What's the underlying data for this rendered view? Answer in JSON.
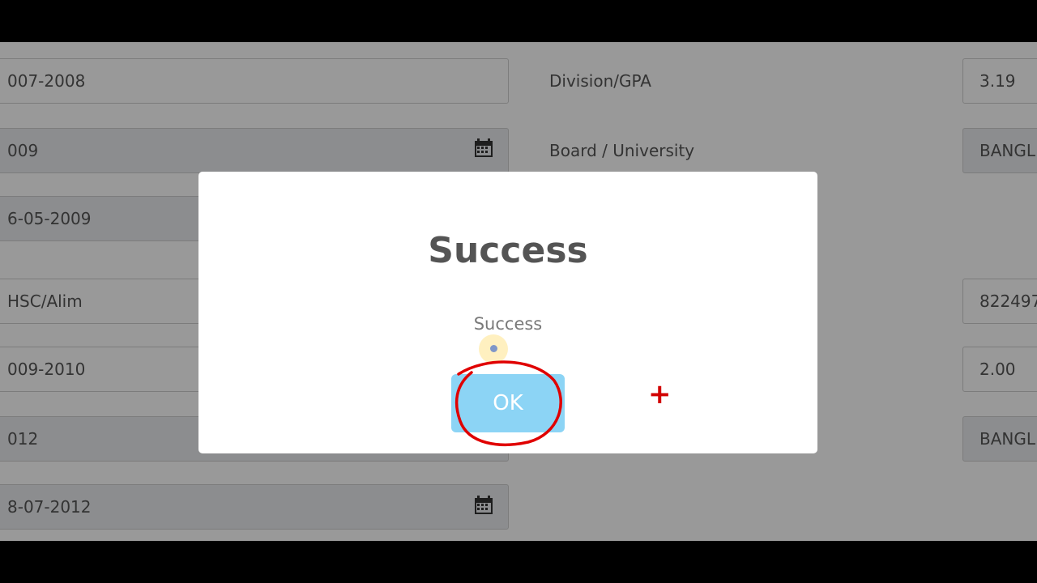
{
  "form": {
    "left_fields": [
      "007-2008",
      "009",
      "6-05-2009",
      "HSC/Alim",
      "009-2010",
      "012",
      "8-07-2012"
    ],
    "labels": {
      "division_gpa": "Division/GPA",
      "board_university": "Board / University"
    },
    "right_fields": [
      "3.19",
      "BANGL",
      "822497",
      "2.00",
      "BANGL"
    ],
    "icons": {
      "calendar": "calendar-icon"
    }
  },
  "dialog": {
    "title": "Success",
    "message": "Success",
    "ok_label": "OK"
  },
  "annotation": {
    "circle_color": "#e00000",
    "crosshair": "+"
  }
}
